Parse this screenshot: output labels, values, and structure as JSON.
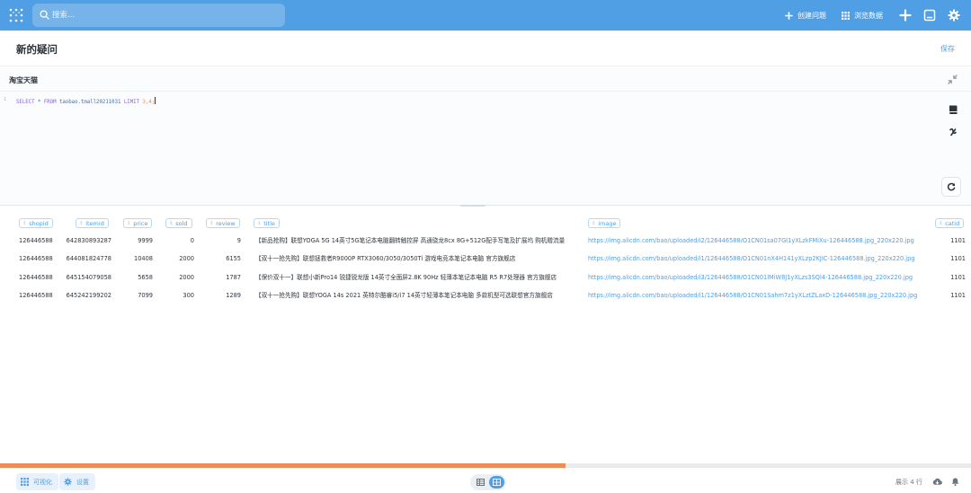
{
  "search": {
    "placeholder": "搜索..."
  },
  "nav": {
    "create_question": "创建问题",
    "browse_data": "浏览数据"
  },
  "page": {
    "title": "新的疑问",
    "save_label": "保存"
  },
  "editor": {
    "database": "淘宝天猫",
    "line_number": "1",
    "sql": {
      "select": "SELECT",
      "star": " * ",
      "from": "FROM",
      "table": " taobao.tmall20211031 ",
      "limit": "LIMIT",
      "args": " 3,4;"
    }
  },
  "table": {
    "columns": [
      "shopid",
      "itemid",
      "price",
      "sold",
      "review",
      "title",
      "image",
      "catid"
    ],
    "rows": [
      [
        "126446588",
        "642830893287",
        "9999",
        "0",
        "9",
        "【新品抢购】联想YOGA 5G 14英寸5G笔记本电脑翻转触控屏 高通骁龙8cx 8G+512G配手写笔及扩展坞 购机赠流量",
        "https://img.alicdn.com/bao/uploaded/i2/126446588/O1CN01sa07GI1yXLzkFMiXu-126446588.jpg_220x220.jpg",
        "1101"
      ],
      [
        "126446588",
        "644081824778",
        "10408",
        "2000",
        "6155",
        "【双十一抢先购】联想拯救者R9000P RTX3060/3050/3050Ti 游戏电竞本笔记本电脑 官方旗舰店",
        "https://img.alicdn.com/bao/uploaded/i1/126446588/O1CN01nX4H141yXLzp2KJIC-126446588.jpg_220x220.jpg",
        "1101"
      ],
      [
        "126446588",
        "645154079058",
        "5658",
        "2000",
        "1787",
        "【保价双十一】联想小新Pro14 锐捷锐龙版 14英寸全面屏2.8K 90Hz 轻薄本笔记本电脑 R5 R7处理器 官方旗舰店",
        "https://img.alicdn.com/bao/uploaded/i3/126446588/O1CN01lMiW8J1yXLzs3SQl4-126446588.jpg_220x220.jpg",
        "1101"
      ],
      [
        "126446588",
        "645242199202",
        "7099",
        "300",
        "1289",
        "【双十一抢先购】联想YOGA 14s 2021 英特尔酷睿i5/i7 14英寸轻薄本笔记本电脑 多款机型可选联想官方旗舰店",
        "https://img.alicdn.com/bao/uploaded/i1/126446588/O1CN01Sahm7z1yXLztZLaxD-126446588.jpg_220x220.jpg",
        "1101"
      ]
    ]
  },
  "progress": {
    "fraction": 0.582
  },
  "footer": {
    "visualize_label": "可视化",
    "settings_label": "设置",
    "row_count": "展示 4 行"
  },
  "colors": {
    "brand": "#509ee3",
    "progress": "#ee8c58"
  },
  "icons": [
    "logo-icon",
    "search-icon",
    "plus-icon",
    "grid-icon",
    "new-icon",
    "snippet-icon",
    "gear-icon",
    "collapse-icon",
    "book-icon",
    "variable-icon",
    "refresh-icon",
    "table-icon",
    "chart-icon",
    "download-icon",
    "bell-icon"
  ]
}
